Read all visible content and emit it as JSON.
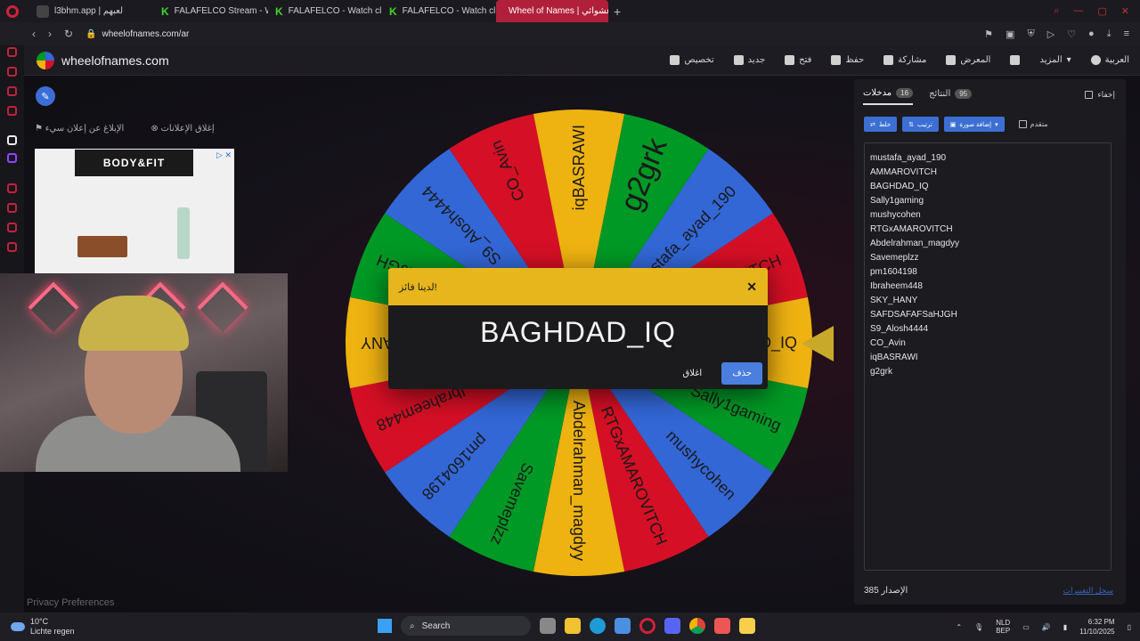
{
  "browser": {
    "tabs": [
      {
        "label": "l3bhm.app | لعبهم",
        "active": false
      },
      {
        "label": "FALAFELCO Stream - Wat",
        "active": false
      },
      {
        "label": "FALAFELCO - Watch clip",
        "active": false
      },
      {
        "label": "FALAFELCO - Watch clip",
        "active": false
      },
      {
        "label": "Wheel of Names | عشوائي",
        "active": true
      }
    ],
    "url": "wheelofnames.com/ar"
  },
  "site": {
    "name": "wheelofnames.com",
    "menu": [
      "العربية",
      "المزيد",
      "المعرض",
      "مشاركة",
      "حفظ",
      "فتح",
      "جديد",
      "تخصيص"
    ],
    "ad_report": "الإبلاغ عن إعلان سيء",
    "ad_close": "إغلاق الإعلانات",
    "ad_brand": "BODY&FIT",
    "privacy": "Privacy Preferences"
  },
  "wheel": {
    "labels": [
      "mustafa_ayad_190",
      "AMMAROVITCH",
      "BAGHDAD_IQ",
      "Sally1gaming",
      "mushycohen",
      "RTGxAMAROVITCH",
      "Abdelrahman_magdyy",
      "Savemeplzz",
      "pm1604198",
      "Ibraheem448",
      "SKY_HANY",
      "SAFDSAFAFSaHJGH",
      "S9_Alosh4444",
      "CO_Avin",
      "iqBASRAWI",
      "g2grk"
    ],
    "colors": [
      "#3367d6",
      "#d50f25",
      "#eeb211",
      "#009925"
    ]
  },
  "modal": {
    "title": "لدينا فائز!",
    "winner": "BAGHDAD_IQ",
    "close_label": "اغلاق",
    "remove_label": "حذف"
  },
  "panel": {
    "tab_entries": "مدخلات",
    "tab_entries_count": "16",
    "tab_results": "النتائج",
    "tab_results_count": "95",
    "hide_label": "إخفاء",
    "shuffle_label": "خلط",
    "sort_label": "ترتيب",
    "add_image_label": "إضافة صورة",
    "advanced_label": "متقدم",
    "entries": [
      "mustafa_ayad_190",
      "AMMAROVITCH",
      "BAGHDAD_IQ",
      "Sally1gaming",
      "mushycohen",
      "RTGxAMAROVITCH",
      "Abdelrahman_magdyy",
      "Savemeplzz",
      "pm1604198",
      "Ibraheem448",
      "SKY_HANY",
      "SAFDSAFAFSaHJGH",
      "S9_Alosh4444",
      "CO_Avin",
      "iqBASRAWI",
      "g2grk"
    ],
    "version_label": "الإصدار",
    "version": "385",
    "saved_label": "سجل التغييرات"
  },
  "taskbar": {
    "temp": "10°C",
    "weather": "Lichte regen",
    "search": "Search",
    "lang": "NLD",
    "lang2": "BEP",
    "time": "6:32 PM",
    "date": "11/10/2025"
  }
}
